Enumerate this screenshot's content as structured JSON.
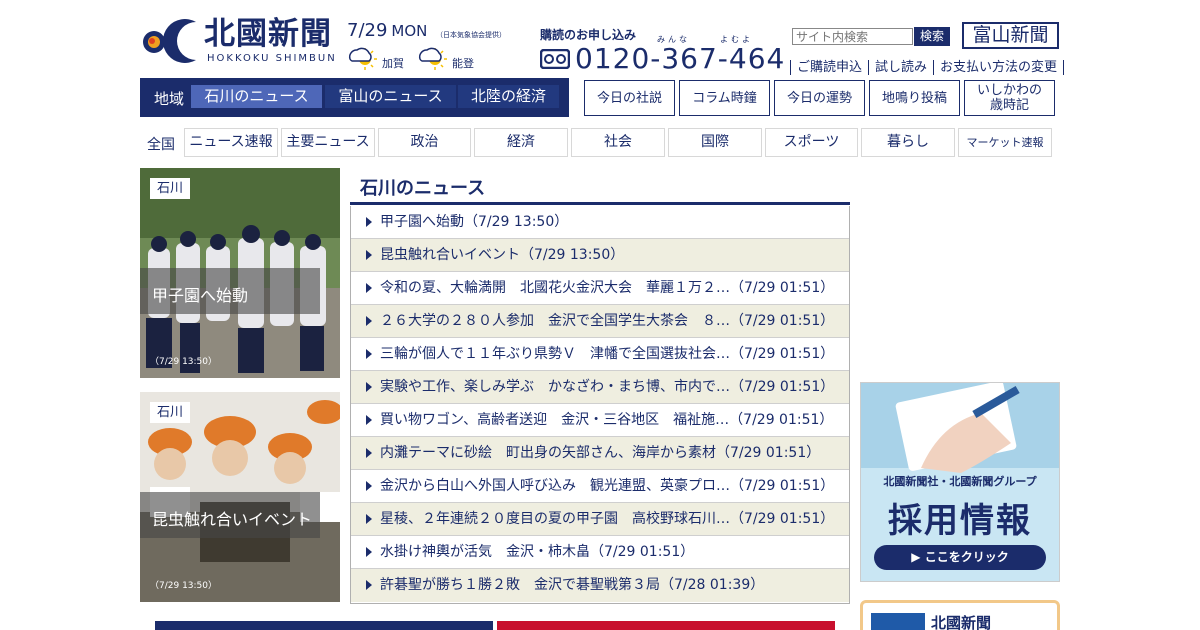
{
  "header": {
    "logo_jp": "北國新聞",
    "logo_en": "HOKKOKU SHIMBUN",
    "date": "7/29",
    "weekday": "MON",
    "date_note": "（日本気象協会提供）",
    "weather": [
      {
        "place": "加賀",
        "icon": "partly-sunny-icon"
      },
      {
        "place": "能登",
        "icon": "partly-sunny-icon"
      }
    ],
    "subscription_label": "購読のお申し込み",
    "phone_ruby_1": "みんな",
    "phone_ruby_2": "よむよ",
    "phone_number": "0120-367-464",
    "search_placeholder": "サイト内検索",
    "search_button": "検索",
    "toyama_logo": "富山新聞",
    "links": [
      "ご購読申込",
      "試し読み",
      "お支払い方法の変更"
    ]
  },
  "region_nav": {
    "label": "地域",
    "tabs": [
      {
        "label": "石川のニュース",
        "active": true
      },
      {
        "label": "富山のニュース",
        "active": false
      },
      {
        "label": "北陸の経済",
        "active": false
      }
    ]
  },
  "feature_buttons": [
    "今日の社説",
    "コラム時鐘",
    "今日の運勢",
    "地鳴り投稿",
    "いしかわの",
    "歳時記"
  ],
  "categories": {
    "label": "全国",
    "items": [
      "ニュース速報",
      "主要ニュース",
      "政治",
      "経済",
      "社会",
      "国際",
      "スポーツ",
      "暮らし",
      "マーケット速報"
    ]
  },
  "photo_cards": [
    {
      "tag": "石川",
      "caption": "甲子園へ始動",
      "time": "（7/29 13:50）"
    },
    {
      "tag": "石川",
      "caption": "昆虫触れ合いイベント",
      "time": "（7/29 13:50）"
    }
  ],
  "news": {
    "title": "石川のニュース",
    "items": [
      "甲子園へ始動（7/29 13:50）",
      "昆虫触れ合いイベント（7/29 13:50）",
      "令和の夏、大輪満開　北國花火金沢大会　華麗１万２…（7/29 01:51）",
      "２６大学の２８０人参加　金沢で全国学生大茶会　８…（7/29 01:51）",
      "三輪が個人で１１年ぶり県勢Ｖ　津幡で全国選抜社会…（7/29 01:51）",
      "実験や工作、楽しみ学ぶ　かなざわ・まち博、市内で…（7/29 01:51）",
      "買い物ワゴン、高齢者送迎　金沢・三谷地区　福祉施…（7/29 01:51）",
      "内灘テーマに砂絵　町出身の矢部さん、海岸から素材（7/29 01:51）",
      "金沢から白山へ外国人呼び込み　観光連盟、英豪プロ…（7/29 01:51）",
      "星稜、２年連続２０度目の夏の甲子園　高校野球石川…（7/29 01:51）",
      "水掛け神輿が活気　金沢・柿木畠（7/29 01:51）",
      "許碁聖が勝ち１勝２敗　金沢で碁聖戦第３局（7/28 01:39）"
    ]
  },
  "banner": {
    "line1": "北國新聞社・北國新聞グループ",
    "line2": "採用情報",
    "button": "▶ ここをクリック"
  },
  "promo": {
    "text": "北國新聞"
  },
  "colors": {
    "navy": "#1b2c6b",
    "active_tab": "#4e67b8",
    "stripe": "#efeee0"
  }
}
